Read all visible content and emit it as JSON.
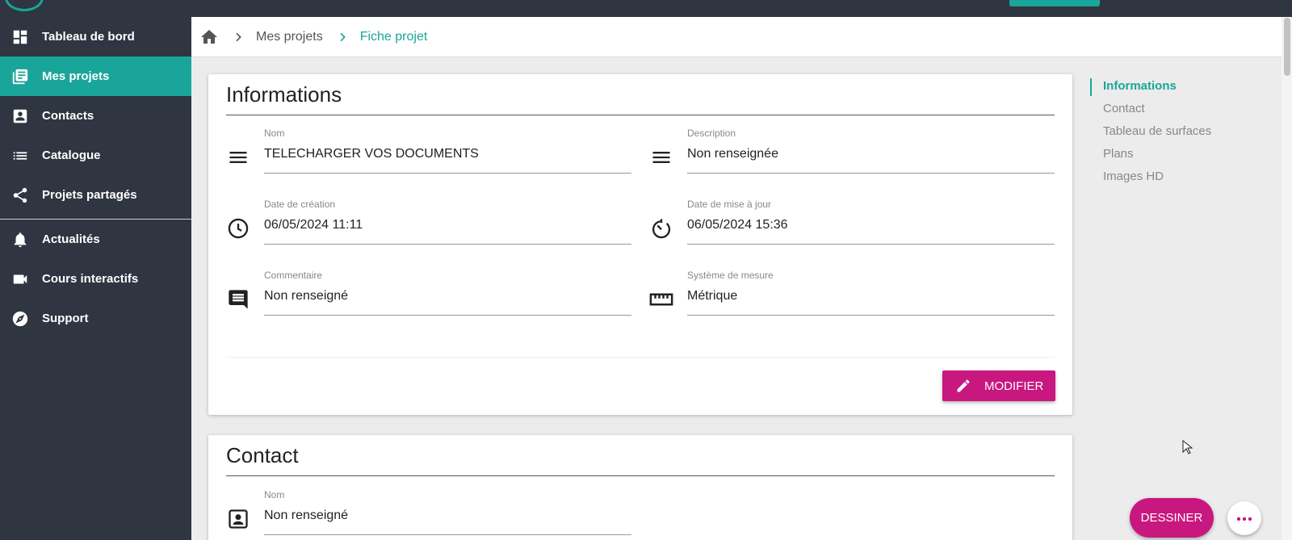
{
  "colors": {
    "accent": "#1aa59a",
    "primary_button": "#c8177f",
    "sidebar": "#2f3541"
  },
  "sidebar": {
    "items": [
      {
        "label": "Tableau de bord",
        "icon": "dashboard-icon"
      },
      {
        "label": "Mes projets",
        "icon": "projects-icon",
        "active": true
      },
      {
        "label": "Contacts",
        "icon": "contact-card-icon"
      },
      {
        "label": "Catalogue",
        "icon": "list-icon"
      },
      {
        "label": "Projets partagés",
        "icon": "share-icon"
      },
      {
        "label": "Actualités",
        "icon": "bell-icon"
      },
      {
        "label": "Cours interactifs",
        "icon": "video-camera-icon"
      },
      {
        "label": "Support",
        "icon": "compass-icon"
      }
    ]
  },
  "breadcrumb": {
    "items": [
      "Mes projets",
      "Fiche projet"
    ]
  },
  "informations": {
    "title": "Informations",
    "fields": {
      "nom": {
        "label": "Nom",
        "value": "TELECHARGER VOS DOCUMENTS",
        "icon": "lines-icon"
      },
      "description": {
        "label": "Description",
        "value": "Non renseignée",
        "icon": "lines-icon"
      },
      "date_creation": {
        "label": "Date de création",
        "value": "06/05/2024 11:11",
        "icon": "clock-icon"
      },
      "date_maj": {
        "label": "Date de mise à jour",
        "value": "06/05/2024 15:36",
        "icon": "timer-icon"
      },
      "commentaire": {
        "label": "Commentaire",
        "value": "Non renseigné",
        "icon": "comment-icon"
      },
      "systeme": {
        "label": "Système de mesure",
        "value": "Métrique",
        "icon": "ruler-icon"
      }
    },
    "modifier_label": "MODIFIER"
  },
  "contact": {
    "title": "Contact",
    "fields": {
      "nom": {
        "label": "Nom",
        "value": "Non renseigné",
        "icon": "contact-card-icon"
      }
    }
  },
  "toc": {
    "items": [
      "Informations",
      "Contact",
      "Tableau de surfaces",
      "Plans",
      "Images HD"
    ]
  },
  "fab": {
    "dessiner_label": "DESSINER"
  }
}
